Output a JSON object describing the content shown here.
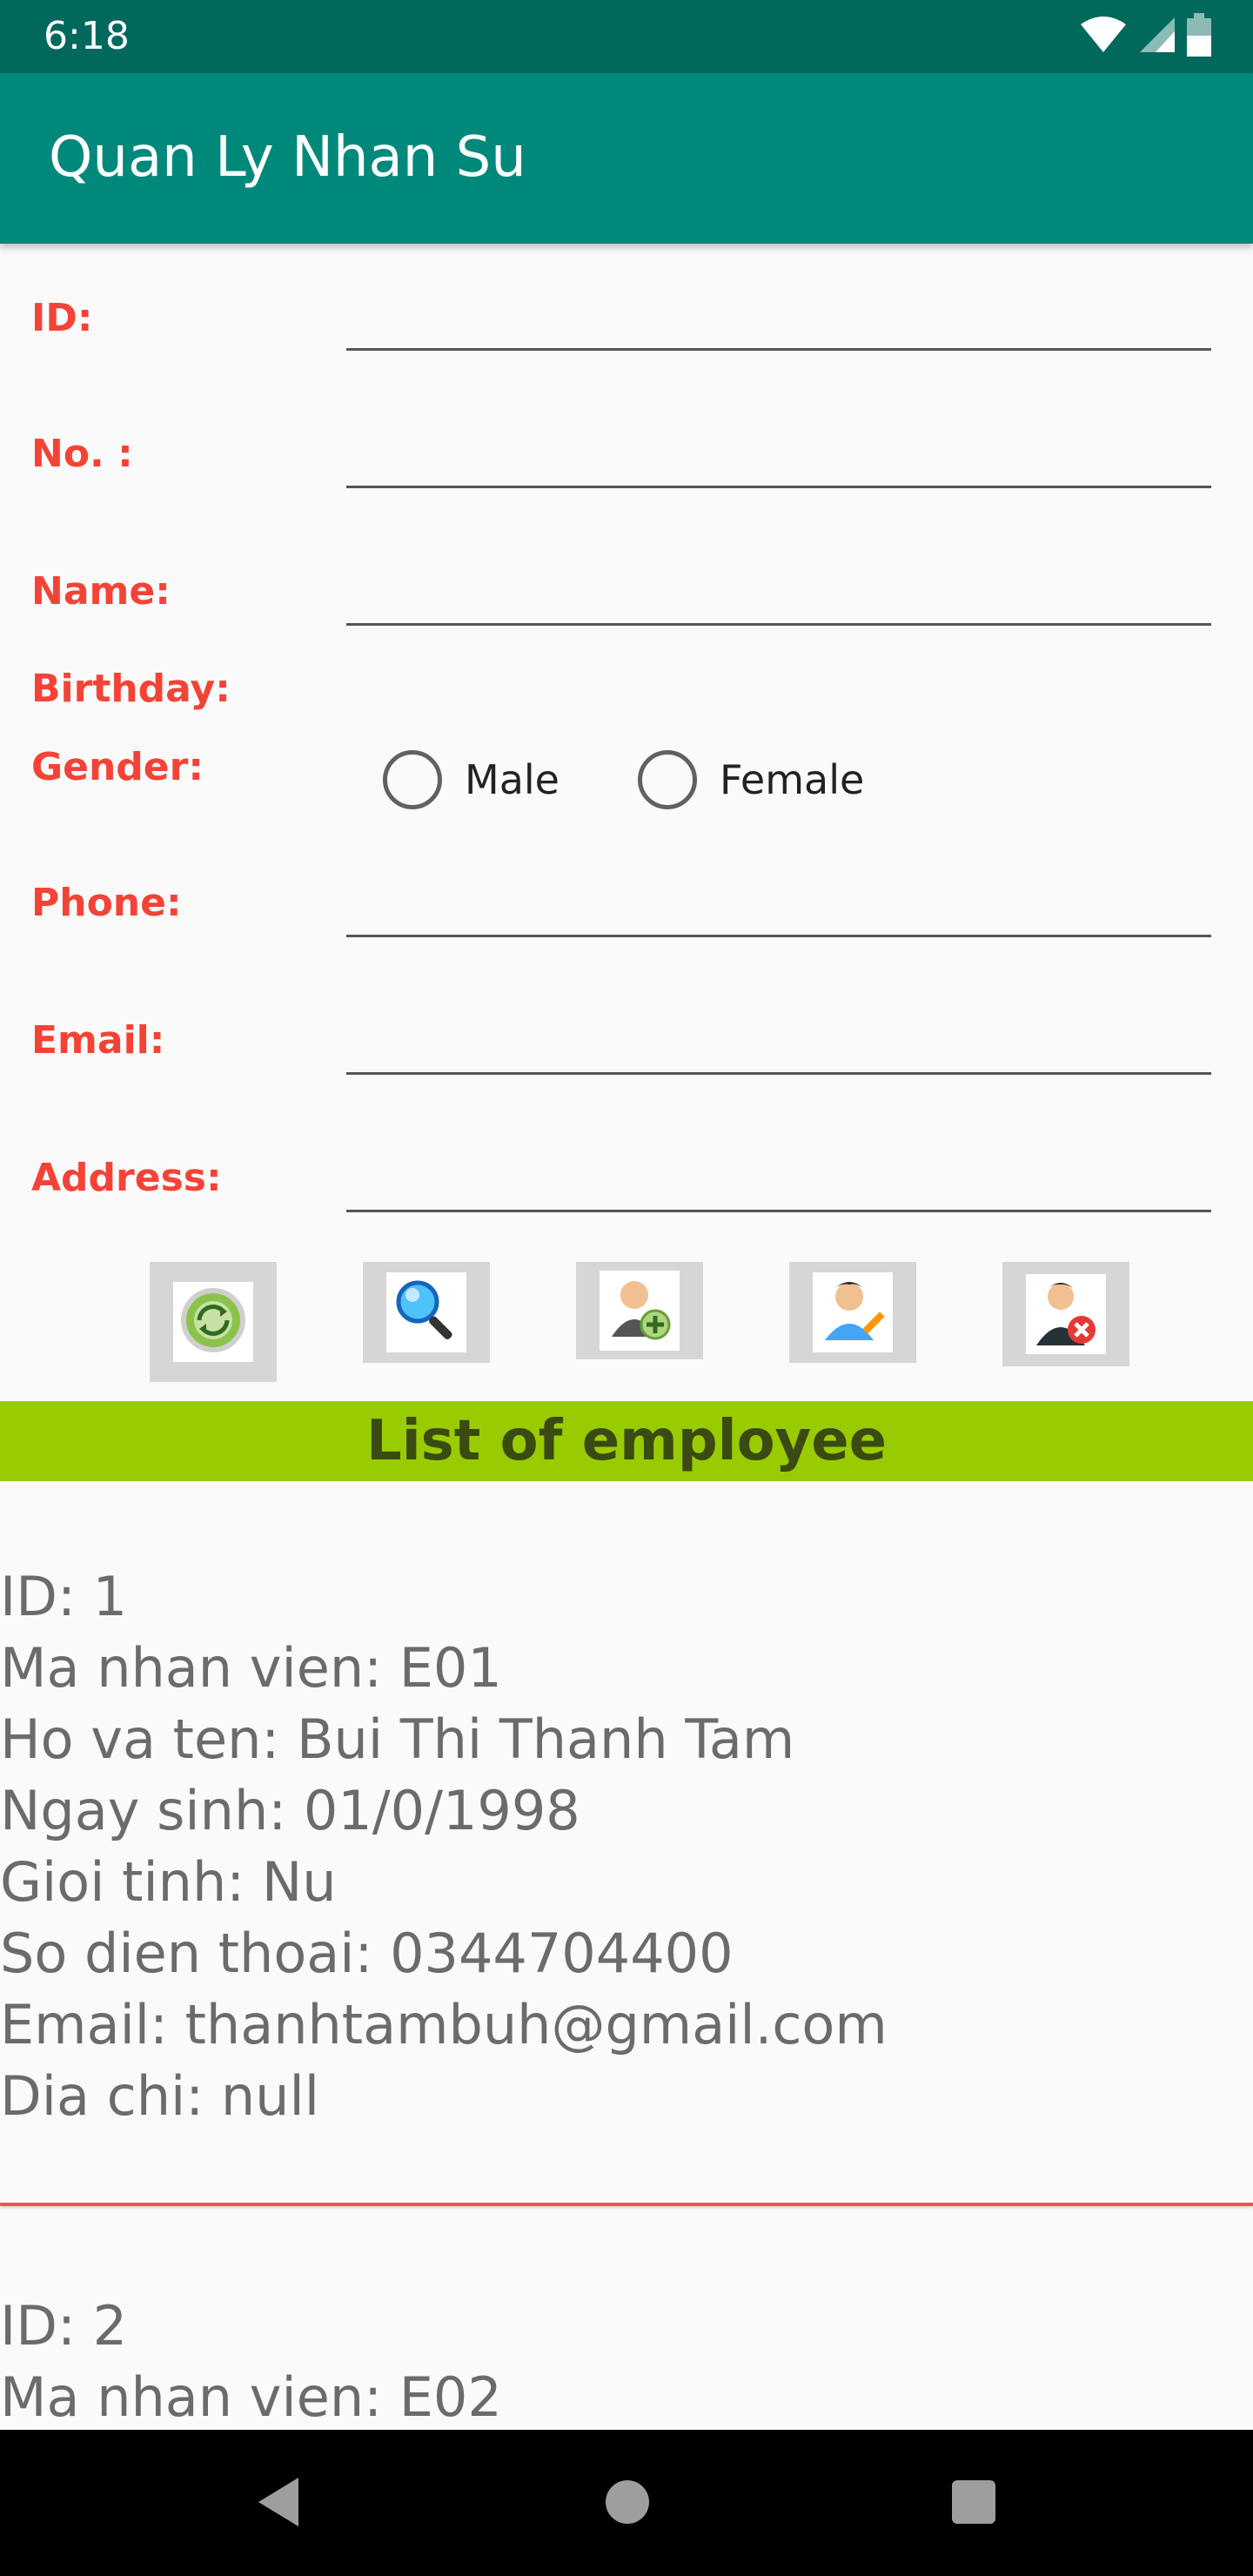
{
  "status_bar": {
    "time": "6:18"
  },
  "app_bar": {
    "title": "Quan Ly Nhan Su"
  },
  "form": {
    "id_label": "ID:",
    "no_label": "No. :",
    "name_label": "Name:",
    "birthday_label": "Birthday:",
    "gender_label": "Gender:",
    "gender_options": [
      "Male",
      "Female"
    ],
    "phone_label": "Phone:",
    "email_label": "Email:",
    "address_label": "Address:",
    "id_value": "",
    "no_value": "",
    "name_value": "",
    "phone_value": "",
    "email_value": "",
    "address_value": ""
  },
  "actions": [
    {
      "icon": "refresh-icon"
    },
    {
      "icon": "search-icon"
    },
    {
      "icon": "add-user-icon"
    },
    {
      "icon": "edit-user-icon"
    },
    {
      "icon": "delete-user-icon"
    }
  ],
  "list": {
    "title": "List of employee",
    "records": [
      {
        "id_line": "ID: 1",
        "code_line": "Ma nhan vien: E01",
        "name_line": "Ho va ten: Bui Thi Thanh Tam",
        "birthday_line": "Ngay sinh: 01/0/1998",
        "gender_line": "Gioi tinh: Nu",
        "phone_line": "So dien thoai: 0344704400",
        "email_line": "Email: thanhtambuh@gmail.com",
        "address_line": "Dia chi: null"
      },
      {
        "id_line": "ID: 2",
        "code_line": "Ma nhan vien: E02"
      }
    ]
  },
  "colors": {
    "status_bar": "#00695c",
    "app_bar": "#00897b",
    "label": "#f44336",
    "list_header": "#99cc00",
    "divider": "#ef5350"
  }
}
